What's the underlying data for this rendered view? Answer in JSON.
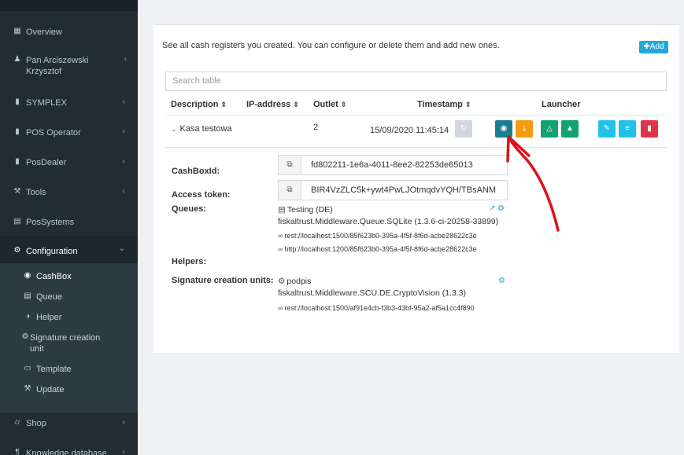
{
  "sidebar": {
    "items": [
      {
        "label": "Overview",
        "icon": "grid-icon"
      },
      {
        "label": "Pan Arciszewski Krzysztof",
        "icon": "user-icon"
      },
      {
        "label": "SYMPLEX",
        "icon": "book-icon"
      },
      {
        "label": "POS Operator",
        "icon": "book-icon"
      },
      {
        "label": "PosDealer",
        "icon": "book-icon"
      },
      {
        "label": "Tools",
        "icon": "wrench-icon"
      },
      {
        "label": "PosSystems",
        "icon": "cash-register-icon"
      },
      {
        "label": "Configuration",
        "icon": "gears-icon"
      },
      {
        "label": "Shop",
        "icon": "basket-icon"
      },
      {
        "label": "Knowledge database",
        "icon": "paragraph-icon"
      }
    ],
    "submenu": [
      {
        "label": "CashBox",
        "icon": "globe-icon"
      },
      {
        "label": "Queue",
        "icon": "database-icon"
      },
      {
        "label": "Helper",
        "icon": "half-circle-icon"
      },
      {
        "label": "Signature creation unit",
        "icon": "cog-icon"
      },
      {
        "label": "Template",
        "icon": "file-icon"
      },
      {
        "label": "Update",
        "icon": "wrench-icon"
      }
    ]
  },
  "main": {
    "intro": "See all cash registers you created. You can configure or delete them and add new ones.",
    "add_label": "Add",
    "search_placeholder": "Search table",
    "columns": [
      "Description",
      "IP-address",
      "Outlet",
      "Timestamp",
      "Launcher"
    ],
    "row": {
      "description": "Kasa testowa",
      "outlet": "2",
      "timestamp": "15/09/2020 11:45:14"
    },
    "details": {
      "cashboxid_label": "CashBoxId:",
      "cashboxid_value": "fd802211-1e6a-4011-8ee2-82253de65013",
      "token_label": "Access token:",
      "token_value": "BIR4VzZLC5k+ywt4PwLJOtmqdvYQH/TBsANM",
      "queues_label": "Queues:",
      "queue_name": "Testing (DE)",
      "queue_package": "fiskaltrust.Middleware.Queue.SQLite (1.3.6-ci-20258-33899)",
      "queue_url1": "rest://localhost:1500/85f623b0-395a-4f5f-8f6d-acbe28622c3e",
      "queue_url2": "http://localhost:1200/85f623b0-395a-4f5f-8f6d-acbe28622c3e",
      "helpers_label": "Helpers:",
      "scu_label": "Signature creation units:",
      "scu_name": "podpis",
      "scu_package": "fiskaltrust.Middleware.SCU.DE.CryptoVision (1.3.3)",
      "scu_url": "rest://localhost:1500/af91e4cb-f3b3-43bf-95a2-af5a1cc4f890"
    },
    "button_colors": {
      "refresh": "#d2d6de",
      "teal": "#1a7e8f",
      "orange": "#f39c12",
      "green": "#12a370",
      "cyan": "#22c1e8",
      "red": "#e0344c"
    },
    "annotation_color": "#e0101a"
  }
}
